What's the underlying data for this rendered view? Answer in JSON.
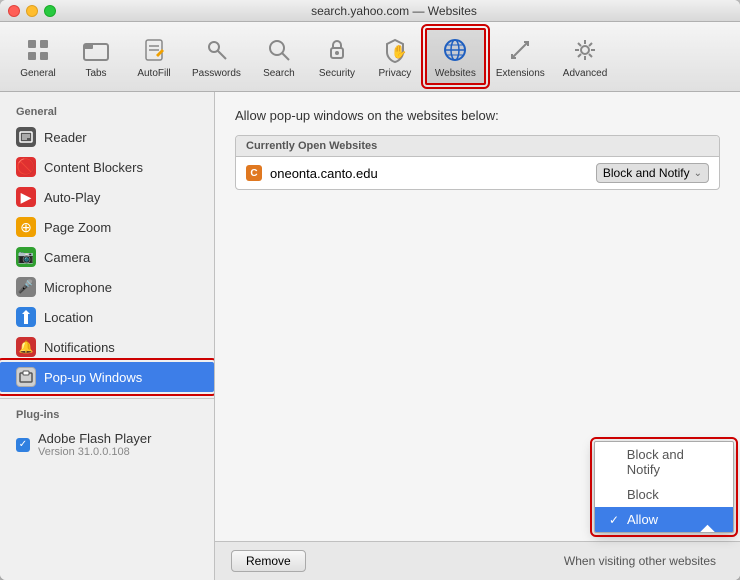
{
  "window": {
    "title": "search.yahoo.com — Websites"
  },
  "toolbar": {
    "items": [
      {
        "id": "general",
        "label": "General",
        "icon": "⊞"
      },
      {
        "id": "tabs",
        "label": "Tabs",
        "icon": "▦"
      },
      {
        "id": "autofill",
        "label": "AutoFill",
        "icon": "✏️"
      },
      {
        "id": "passwords",
        "label": "Passwords",
        "icon": "🔑"
      },
      {
        "id": "search",
        "label": "Search",
        "icon": "🔍"
      },
      {
        "id": "security",
        "label": "Security",
        "icon": "🔒"
      },
      {
        "id": "privacy",
        "label": "Privacy",
        "icon": "✋"
      },
      {
        "id": "websites",
        "label": "Websites",
        "icon": "🌐",
        "active": true
      },
      {
        "id": "extensions",
        "label": "Extensions",
        "icon": "↗"
      },
      {
        "id": "advanced",
        "label": "Advanced",
        "icon": "⚙️"
      }
    ]
  },
  "sidebar": {
    "general_label": "General",
    "plugins_label": "Plug-ins",
    "items": [
      {
        "id": "reader",
        "label": "Reader",
        "iconChar": "≡",
        "iconClass": "icon-reader"
      },
      {
        "id": "content-blockers",
        "label": "Content Blockers",
        "iconChar": "●",
        "iconClass": "icon-content"
      },
      {
        "id": "auto-play",
        "label": "Auto-Play",
        "iconChar": "▶",
        "iconClass": "icon-autoplay"
      },
      {
        "id": "page-zoom",
        "label": "Page Zoom",
        "iconChar": "⊕",
        "iconClass": "icon-pagezoom"
      },
      {
        "id": "camera",
        "label": "Camera",
        "iconChar": "📷",
        "iconClass": "icon-camera"
      },
      {
        "id": "microphone",
        "label": "Microphone",
        "iconChar": "🎤",
        "iconClass": "icon-microphone"
      },
      {
        "id": "location",
        "label": "Location",
        "iconChar": "✈",
        "iconClass": "icon-location"
      },
      {
        "id": "notifications",
        "label": "Notifications",
        "iconChar": "●",
        "iconClass": "icon-notifications"
      },
      {
        "id": "popup-windows",
        "label": "Pop-up Windows",
        "iconChar": "▣",
        "iconClass": "icon-popup",
        "active": true
      }
    ],
    "plugin_items": [
      {
        "id": "flash",
        "label": "Adobe Flash Player",
        "version": "Version 31.0.0.108",
        "checked": true
      }
    ]
  },
  "content": {
    "title": "Allow pop-up windows on the websites  below:",
    "table": {
      "header": "Currently Open Websites",
      "rows": [
        {
          "site": "oneonta.canto.edu",
          "icon": "C",
          "control": "Block and Notify"
        }
      ]
    },
    "bottom": {
      "remove_label": "Remove",
      "when_visiting_label": "When visiting other websites"
    },
    "dropdown": {
      "items": [
        {
          "label": "Block and Notify",
          "selected": false
        },
        {
          "label": "Block",
          "selected": false
        },
        {
          "label": "Allow",
          "selected": true
        }
      ]
    }
  }
}
